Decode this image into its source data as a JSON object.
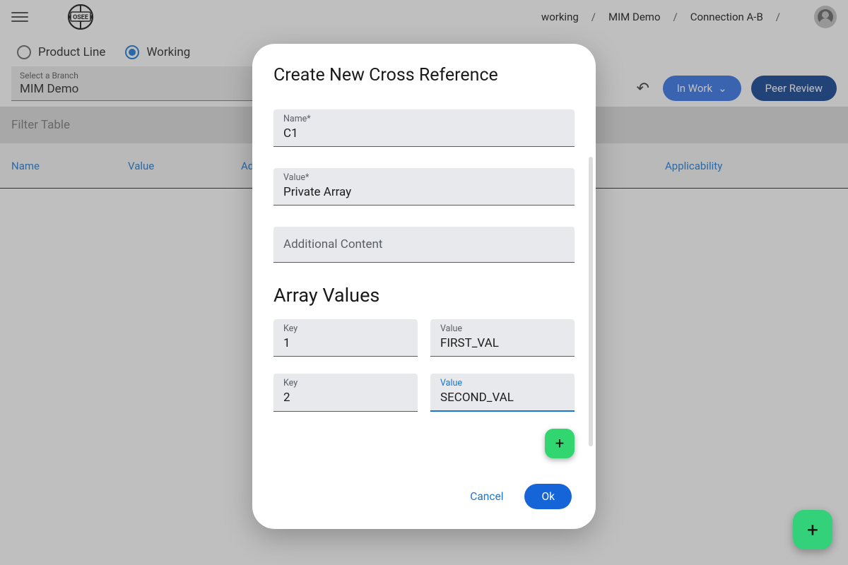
{
  "breadcrumb": {
    "b1": "working",
    "b2": "MIM Demo",
    "b3": "Connection A-B"
  },
  "radios": {
    "product_line": "Product Line",
    "working": "Working"
  },
  "branch": {
    "label": "Select a Branch",
    "value": "MIM Demo"
  },
  "actions": {
    "in_work": "In Work",
    "peer_review": "Peer Review"
  },
  "filter": {
    "placeholder": "Filter Table"
  },
  "columns": {
    "name": "Name",
    "value": "Value",
    "additional": "Ad",
    "applicability": "Applicability"
  },
  "dialog": {
    "title": "Create New Cross Reference",
    "name_label": "Name*",
    "name_value": "C1",
    "value_label": "Value*",
    "value_value": "Private Array",
    "additional_label": "Additional Content",
    "array_section": "Array Values",
    "rows": [
      {
        "key_label": "Key",
        "key": "1",
        "val_label": "Value",
        "val": "FIRST_VAL"
      },
      {
        "key_label": "Key",
        "key": "2",
        "val_label": "Value",
        "val": "SECOND_VAL"
      }
    ],
    "cancel": "Cancel",
    "ok": "Ok"
  },
  "icons": {
    "plus": "+",
    "chevron_down": "⌄",
    "undo": "↶"
  }
}
